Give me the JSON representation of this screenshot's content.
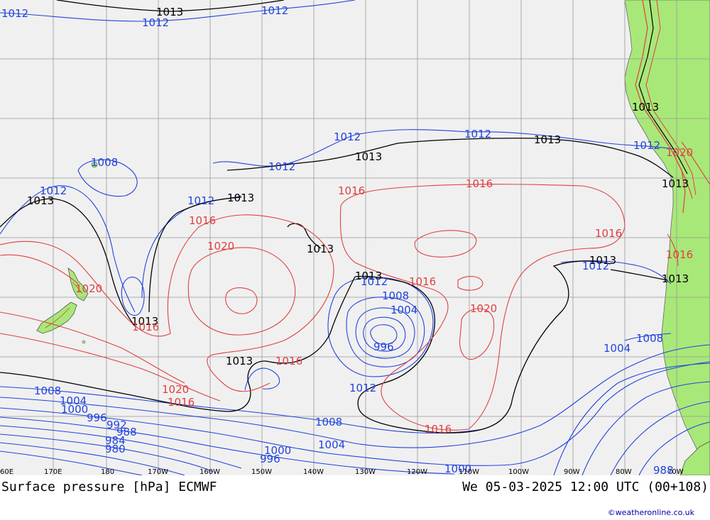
{
  "title": "Surface pressure [hPa] ECMWF",
  "valid_time": "We 05-03-2025 12:00 UTC (00+108)",
  "credit": "©weatheronline.co.uk",
  "longitude_ticks": [
    "60E",
    "170E",
    "180",
    "170W",
    "160W",
    "150W",
    "140W",
    "130W",
    "120W",
    "110W",
    "100W",
    "90W",
    "80W",
    "70W"
  ],
  "colors": {
    "ocean": "#f0f0f0",
    "land": "#a8e878",
    "grid": "#999999",
    "isobar_low": "#2244dd",
    "isobar_ref": "#000000",
    "isobar_high": "#e04040"
  },
  "isobar_labels": {
    "black": [
      "1013",
      "1013",
      "1013",
      "1013",
      "1013",
      "1013",
      "1013",
      "1013",
      "1013",
      "1013",
      "1013",
      "1013",
      "1013"
    ],
    "blue": [
      "1012",
      "1012",
      "1012",
      "1012",
      "1012",
      "1008",
      "1012",
      "1012",
      "1012",
      "1012",
      "1008",
      "1004",
      "996",
      "1012",
      "1008",
      "1004",
      "1000",
      "996",
      "992",
      "988",
      "984",
      "980",
      "1008",
      "1004",
      "1000",
      "996",
      "1000",
      "1012",
      "1008",
      "1004",
      "1012",
      "988"
    ],
    "red": [
      "1016",
      "1020",
      "1016",
      "1020",
      "1016",
      "1016",
      "1020",
      "1016",
      "1016",
      "1016",
      "1016",
      "1016",
      "1020",
      "1020",
      "1016"
    ]
  },
  "reference_isobar_hpa": 1013,
  "contour_interval_hpa": 4,
  "lowest_center_hpa": 996
}
